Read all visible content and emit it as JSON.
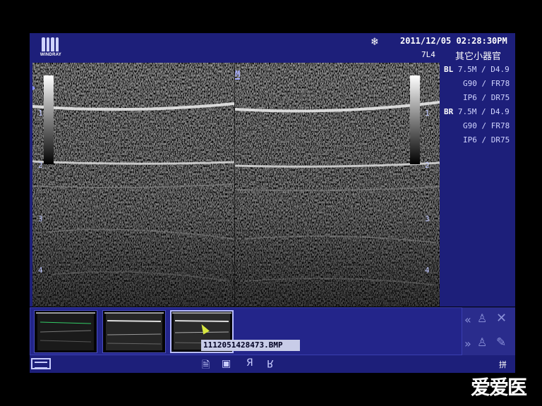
{
  "header": {
    "brand": "WINDRAY",
    "freeze_icon": "snowflake-icon",
    "datetime": "2011/12/05  02:28:30PM",
    "probe": "7L4",
    "preset": "其它小器官"
  },
  "params": {
    "left": {
      "tag": "BL",
      "freq_depth": "7.5M / D4.9",
      "gain_fr": "G90 / FR78",
      "ip_dr": "IP6 / DR75"
    },
    "right": {
      "tag": "BR",
      "freq_depth": "7.5M / D4.9",
      "gain_fr": "G90 / FR78",
      "ip_dr": "IP6 / DR75"
    }
  },
  "image": {
    "marker": "M",
    "depth_labels": [
      "1",
      "2",
      "3",
      "4"
    ]
  },
  "thumbnails": {
    "filename": "1112051428473.BMP",
    "selected_index": 3,
    "count": 3
  },
  "controls": {
    "prev_label": "«",
    "next_label": "»",
    "close_icon": "close-icon",
    "edit_icon": "edit-icon",
    "person_icon": "person-icon"
  },
  "toolbar": {
    "icons": [
      "document-icon",
      "image-export-icon",
      "ya-icon",
      "ya-mirror-icon"
    ],
    "ya": "Я",
    "ya_mirror": "R",
    "merge_label": "拼"
  },
  "watermark": "爱爱医",
  "colors": {
    "panel": "#1d1f7a",
    "text": "#ffffff",
    "param_text": "#d0d4ff"
  }
}
